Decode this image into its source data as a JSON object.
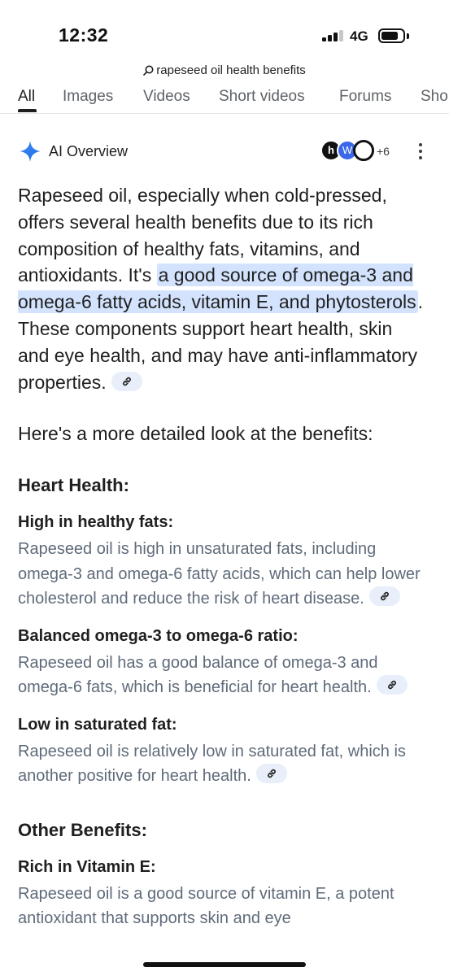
{
  "status_bar": {
    "time": "12:32",
    "network": "4G",
    "signal_bars_active": 3,
    "signal_bars_total": 4,
    "battery_icon": "battery-icon"
  },
  "browser": {
    "query": "rapeseed oil health benefits",
    "search_icon": "search-icon"
  },
  "tabs": [
    {
      "label": "All",
      "active": true
    },
    {
      "label": "Images",
      "active": false
    },
    {
      "label": "Videos",
      "active": false
    },
    {
      "label": "Short videos",
      "active": false
    },
    {
      "label": "Forums",
      "active": false
    },
    {
      "label": "Sho",
      "active": false
    }
  ],
  "ai_overview": {
    "title": "AI Overview",
    "source_icons": [
      "h",
      "W",
      ""
    ],
    "more_sources": "+6",
    "accent_color": "#4285f4",
    "highlight_color": "#d3e3fd",
    "intro_before": "Rapeseed oil, especially when cold-pressed, offers several health benefits due to its rich composition of healthy fats, vitamins, and antioxidants. It's ",
    "intro_highlight": "a good source of omega-3 and omega-6 fatty acids, vitamin E, and phytosterols",
    "intro_after": ". These components support heart health, skin and eye health, and may have anti-inflammatory properties.",
    "lead_in": "Here's a more detailed look at the benefits:",
    "sections": [
      {
        "heading": "Heart Health:",
        "items": [
          {
            "title": "High in healthy fats:",
            "desc": "Rapeseed oil is high in unsaturated fats, including omega-3 and omega-6 fatty acids, which can help lower cholesterol and reduce the risk of heart disease."
          },
          {
            "title": "Balanced omega-3 to omega-6 ratio:",
            "desc": "Rapeseed oil has a good balance of omega-3 and omega-6 fats, which is beneficial for heart health."
          },
          {
            "title": "Low in saturated fat:",
            "desc": "Rapeseed oil is relatively low in saturated fat, which is another positive for heart health."
          }
        ]
      },
      {
        "heading": "Other Benefits:",
        "items": [
          {
            "title": "Rich in Vitamin E:",
            "desc": "Rapeseed oil is a good source of vitamin E, a potent antioxidant that supports skin and eye"
          }
        ]
      }
    ]
  }
}
